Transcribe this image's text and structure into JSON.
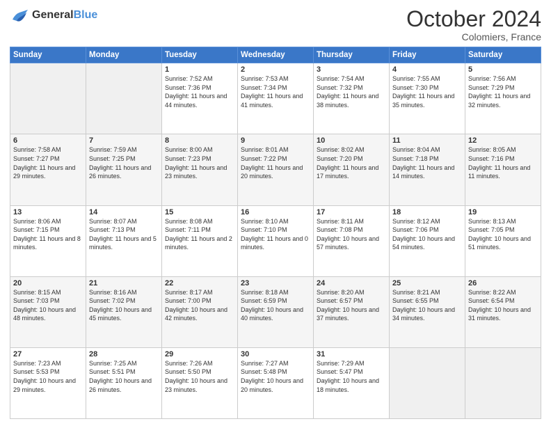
{
  "header": {
    "logo_line1": "General",
    "logo_line2": "Blue",
    "month": "October 2024",
    "location": "Colomiers, France"
  },
  "days_of_week": [
    "Sunday",
    "Monday",
    "Tuesday",
    "Wednesday",
    "Thursday",
    "Friday",
    "Saturday"
  ],
  "weeks": [
    [
      {
        "day": "",
        "sunrise": "",
        "sunset": "",
        "daylight": ""
      },
      {
        "day": "",
        "sunrise": "",
        "sunset": "",
        "daylight": ""
      },
      {
        "day": "1",
        "sunrise": "Sunrise: 7:52 AM",
        "sunset": "Sunset: 7:36 PM",
        "daylight": "Daylight: 11 hours and 44 minutes."
      },
      {
        "day": "2",
        "sunrise": "Sunrise: 7:53 AM",
        "sunset": "Sunset: 7:34 PM",
        "daylight": "Daylight: 11 hours and 41 minutes."
      },
      {
        "day": "3",
        "sunrise": "Sunrise: 7:54 AM",
        "sunset": "Sunset: 7:32 PM",
        "daylight": "Daylight: 11 hours and 38 minutes."
      },
      {
        "day": "4",
        "sunrise": "Sunrise: 7:55 AM",
        "sunset": "Sunset: 7:30 PM",
        "daylight": "Daylight: 11 hours and 35 minutes."
      },
      {
        "day": "5",
        "sunrise": "Sunrise: 7:56 AM",
        "sunset": "Sunset: 7:29 PM",
        "daylight": "Daylight: 11 hours and 32 minutes."
      }
    ],
    [
      {
        "day": "6",
        "sunrise": "Sunrise: 7:58 AM",
        "sunset": "Sunset: 7:27 PM",
        "daylight": "Daylight: 11 hours and 29 minutes."
      },
      {
        "day": "7",
        "sunrise": "Sunrise: 7:59 AM",
        "sunset": "Sunset: 7:25 PM",
        "daylight": "Daylight: 11 hours and 26 minutes."
      },
      {
        "day": "8",
        "sunrise": "Sunrise: 8:00 AM",
        "sunset": "Sunset: 7:23 PM",
        "daylight": "Daylight: 11 hours and 23 minutes."
      },
      {
        "day": "9",
        "sunrise": "Sunrise: 8:01 AM",
        "sunset": "Sunset: 7:22 PM",
        "daylight": "Daylight: 11 hours and 20 minutes."
      },
      {
        "day": "10",
        "sunrise": "Sunrise: 8:02 AM",
        "sunset": "Sunset: 7:20 PM",
        "daylight": "Daylight: 11 hours and 17 minutes."
      },
      {
        "day": "11",
        "sunrise": "Sunrise: 8:04 AM",
        "sunset": "Sunset: 7:18 PM",
        "daylight": "Daylight: 11 hours and 14 minutes."
      },
      {
        "day": "12",
        "sunrise": "Sunrise: 8:05 AM",
        "sunset": "Sunset: 7:16 PM",
        "daylight": "Daylight: 11 hours and 11 minutes."
      }
    ],
    [
      {
        "day": "13",
        "sunrise": "Sunrise: 8:06 AM",
        "sunset": "Sunset: 7:15 PM",
        "daylight": "Daylight: 11 hours and 8 minutes."
      },
      {
        "day": "14",
        "sunrise": "Sunrise: 8:07 AM",
        "sunset": "Sunset: 7:13 PM",
        "daylight": "Daylight: 11 hours and 5 minutes."
      },
      {
        "day": "15",
        "sunrise": "Sunrise: 8:08 AM",
        "sunset": "Sunset: 7:11 PM",
        "daylight": "Daylight: 11 hours and 2 minutes."
      },
      {
        "day": "16",
        "sunrise": "Sunrise: 8:10 AM",
        "sunset": "Sunset: 7:10 PM",
        "daylight": "Daylight: 11 hours and 0 minutes."
      },
      {
        "day": "17",
        "sunrise": "Sunrise: 8:11 AM",
        "sunset": "Sunset: 7:08 PM",
        "daylight": "Daylight: 10 hours and 57 minutes."
      },
      {
        "day": "18",
        "sunrise": "Sunrise: 8:12 AM",
        "sunset": "Sunset: 7:06 PM",
        "daylight": "Daylight: 10 hours and 54 minutes."
      },
      {
        "day": "19",
        "sunrise": "Sunrise: 8:13 AM",
        "sunset": "Sunset: 7:05 PM",
        "daylight": "Daylight: 10 hours and 51 minutes."
      }
    ],
    [
      {
        "day": "20",
        "sunrise": "Sunrise: 8:15 AM",
        "sunset": "Sunset: 7:03 PM",
        "daylight": "Daylight: 10 hours and 48 minutes."
      },
      {
        "day": "21",
        "sunrise": "Sunrise: 8:16 AM",
        "sunset": "Sunset: 7:02 PM",
        "daylight": "Daylight: 10 hours and 45 minutes."
      },
      {
        "day": "22",
        "sunrise": "Sunrise: 8:17 AM",
        "sunset": "Sunset: 7:00 PM",
        "daylight": "Daylight: 10 hours and 42 minutes."
      },
      {
        "day": "23",
        "sunrise": "Sunrise: 8:18 AM",
        "sunset": "Sunset: 6:59 PM",
        "daylight": "Daylight: 10 hours and 40 minutes."
      },
      {
        "day": "24",
        "sunrise": "Sunrise: 8:20 AM",
        "sunset": "Sunset: 6:57 PM",
        "daylight": "Daylight: 10 hours and 37 minutes."
      },
      {
        "day": "25",
        "sunrise": "Sunrise: 8:21 AM",
        "sunset": "Sunset: 6:55 PM",
        "daylight": "Daylight: 10 hours and 34 minutes."
      },
      {
        "day": "26",
        "sunrise": "Sunrise: 8:22 AM",
        "sunset": "Sunset: 6:54 PM",
        "daylight": "Daylight: 10 hours and 31 minutes."
      }
    ],
    [
      {
        "day": "27",
        "sunrise": "Sunrise: 7:23 AM",
        "sunset": "Sunset: 5:53 PM",
        "daylight": "Daylight: 10 hours and 29 minutes."
      },
      {
        "day": "28",
        "sunrise": "Sunrise: 7:25 AM",
        "sunset": "Sunset: 5:51 PM",
        "daylight": "Daylight: 10 hours and 26 minutes."
      },
      {
        "day": "29",
        "sunrise": "Sunrise: 7:26 AM",
        "sunset": "Sunset: 5:50 PM",
        "daylight": "Daylight: 10 hours and 23 minutes."
      },
      {
        "day": "30",
        "sunrise": "Sunrise: 7:27 AM",
        "sunset": "Sunset: 5:48 PM",
        "daylight": "Daylight: 10 hours and 20 minutes."
      },
      {
        "day": "31",
        "sunrise": "Sunrise: 7:29 AM",
        "sunset": "Sunset: 5:47 PM",
        "daylight": "Daylight: 10 hours and 18 minutes."
      },
      {
        "day": "",
        "sunrise": "",
        "sunset": "",
        "daylight": ""
      },
      {
        "day": "",
        "sunrise": "",
        "sunset": "",
        "daylight": ""
      }
    ]
  ]
}
